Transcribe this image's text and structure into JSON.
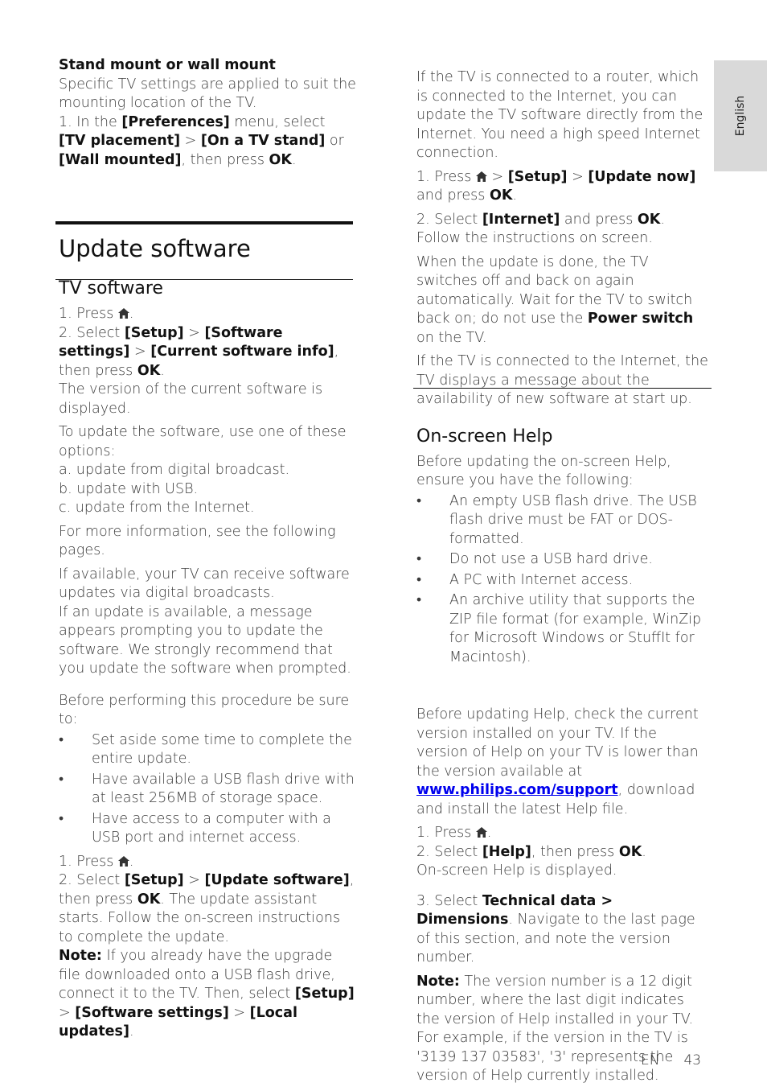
{
  "side_tab": {
    "language": "English"
  },
  "footer": {
    "lang_code": "EN",
    "page_number": "43"
  },
  "left": {
    "mount_title": "Stand mount or wall mount",
    "mount_desc": "Specific TV settings are applied to suit the mounting location of the TV.",
    "mount_step_1": "1. In the ",
    "mount_pref": "[Preferences]",
    "mount_menu_select": " menu, select ",
    "mount_tv_placement": "[TV placement]",
    "mount_gt": " > ",
    "mount_on_stand": "[On a TV stand]",
    "mount_or": " or ",
    "mount_wall": "[Wall mounted]",
    "mount_then": ", then press ",
    "ok": "OK",
    "period": ".",
    "section_title": "Update software",
    "tv_software_title": "TV software",
    "tvs_step1": "1. Press ",
    "tvs_step2_a": "2. Select ",
    "setup": "[Setup]",
    "software_settings": "[Software settings]",
    "current_info": "[Current software info]",
    "then_press": ", then press ",
    "version_displayed": "The version of the current software is displayed.",
    "options_intro": "To update the software, use one of these options:",
    "option_a": "a. update from digital broadcast.",
    "option_b": "b. update with USB.",
    "option_c": "c. update from the Internet.",
    "more_info": "For more information, see the following pages.",
    "broadcast_1": "If available, your TV can receive software updates via digital broadcasts.",
    "broadcast_2": "If an update is available, a message appears prompting you to update the software. We strongly recommend that you update the software when prompted.",
    "before_intro": "Before performing this procedure be sure to:",
    "bullets": [
      "Set aside some time to complete the entire update.",
      "Have available a USB flash drive with at least 256MB of storage space.",
      "Have access to a computer with a USB port and internet access."
    ],
    "usb_step1": "1. Press ",
    "usb_step2_a": "2. Select ",
    "update_software": "[Update software]",
    "usb_step2_b": ". The update assistant starts. Follow the on-screen instructions to complete the update.",
    "note_label": "Note:",
    "note_text": " If you already have the upgrade file downloaded onto a USB flash drive, connect it to the TV. Then, select ",
    "local_updates": "[Local updates]"
  },
  "right": {
    "router_intro": "If the TV is connected to a router, which is connected to the Internet, you can update the TV software directly from the Internet. You need a high speed Internet connection.",
    "step1_a": "1. Press ",
    "setup": "[Setup]",
    "update_now": "[Update now]",
    "and_press": " and press ",
    "ok": "OK",
    "gt": " > ",
    "step2_a": "2. Select ",
    "internet": "[Internet]",
    "step2_b": ". Follow the instructions on screen.",
    "done_text_a": "When the update is done, the TV switches off and back on again automatically. Wait for the TV to switch back on; do not use the ",
    "power_switch": "Power switch",
    "done_text_b": " on the TV.",
    "message_text": "If the TV is connected to the Internet, the TV displays a message about the availability of new software at start up.",
    "help_title": "On-screen Help",
    "help_intro": "Before updating the on-screen Help, ensure you have the following:",
    "help_bullets": [
      "An empty USB flash drive. The USB flash drive must be FAT or DOS-formatted.",
      "Do not use a USB hard drive.",
      "A PC with Internet access.",
      "An archive utility that supports the ZIP file format (for example, WinZip for Microsoft Windows or StuffIt for Macintosh)."
    ],
    "check_text_a": "Before updating Help, check the current version installed on your TV. If the version of Help on your TV is lower than the version available at ",
    "support_link": "www.philips.com/support",
    "check_text_b": ", download and install the latest Help file.",
    "help_step1": "1. Press ",
    "help_step2_a": "2. Select ",
    "help_menu": "[Help]",
    "then_press": ", then press ",
    "help_displayed": "On-screen Help is displayed.",
    "step3_a": "3. Select ",
    "tech_data": "Technical data > Dimensions",
    "step3_b": ". Navigate to the last page of this section, and note the version number.",
    "note_label": "Note:",
    "note_text": " The version number is a 12 digit number, where the last digit indicates the version of Help installed in your TV. For example, if the version in the TV is '3139 137 03583', '3' represents the version of Help currently installed.",
    "bullet_char": "•"
  }
}
